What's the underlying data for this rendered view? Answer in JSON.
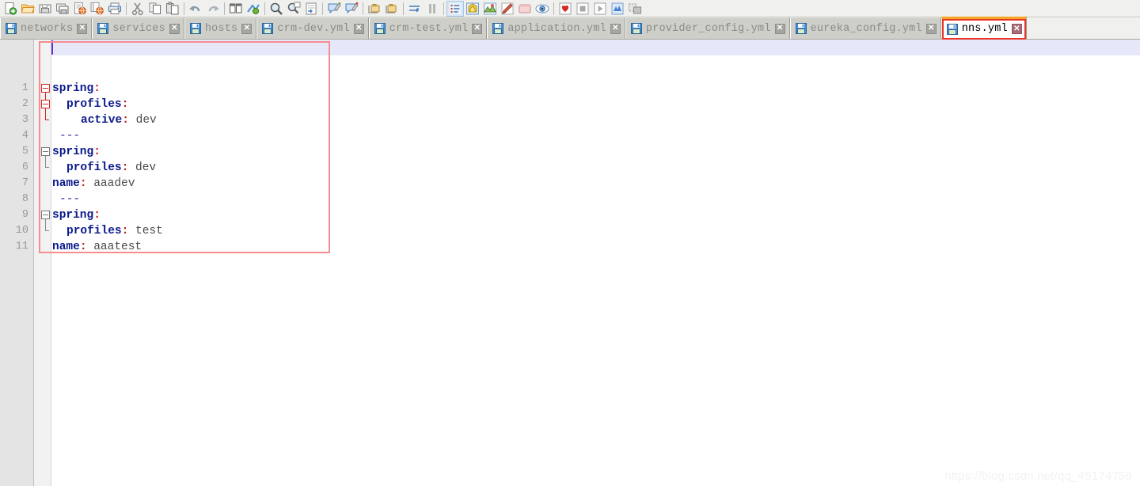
{
  "toolbar": {
    "groups": [
      {
        "items": [
          {
            "name": "new-file-icon",
            "label": "New"
          },
          {
            "name": "open-folder-icon",
            "label": "Open"
          },
          {
            "name": "save-icon",
            "label": "Save"
          },
          {
            "name": "save-all-icon",
            "label": "Save All"
          },
          {
            "name": "export-html-icon",
            "label": "Export to HTML"
          },
          {
            "name": "export-all-html-icon",
            "label": "Export All to HTML"
          },
          {
            "name": "print-icon",
            "label": "Print"
          }
        ]
      },
      {
        "items": [
          {
            "name": "cut-icon",
            "label": "Cut"
          },
          {
            "name": "copy-icon",
            "label": "Copy"
          },
          {
            "name": "paste-icon",
            "label": "Paste"
          }
        ]
      },
      {
        "items": [
          {
            "name": "undo-icon",
            "label": "Undo"
          },
          {
            "name": "redo-icon",
            "label": "Redo"
          }
        ]
      },
      {
        "items": [
          {
            "name": "compare-icon",
            "label": "Compare"
          },
          {
            "name": "sync-scroll-icon",
            "label": "Synchronize"
          }
        ]
      },
      {
        "items": [
          {
            "name": "find-icon",
            "label": "Find"
          },
          {
            "name": "replace-icon",
            "label": "Replace"
          },
          {
            "name": "goto-line-icon",
            "label": "Go To"
          }
        ]
      },
      {
        "items": [
          {
            "name": "comment-block-icon",
            "label": "Comment Block"
          },
          {
            "name": "uncomment-block-icon",
            "label": "Uncomment Block"
          }
        ]
      },
      {
        "items": [
          {
            "name": "indent-icon",
            "label": "Indent"
          },
          {
            "name": "column-mode-icon",
            "label": "Column Mode"
          }
        ]
      },
      {
        "items": [
          {
            "name": "show-all-chars-icon",
            "label": "Show All Characters"
          },
          {
            "name": "word-wrap-icon",
            "label": "Word Wrap"
          },
          {
            "name": "map-icon",
            "label": "Document Map"
          },
          {
            "name": "function-list-icon",
            "label": "Function List"
          },
          {
            "name": "folder-workspace-icon",
            "label": "Folder as Workspace"
          },
          {
            "name": "monitoring-icon",
            "label": "Monitoring"
          }
        ]
      },
      {
        "items": [
          {
            "name": "record-macro-icon",
            "label": "Start Recording"
          },
          {
            "name": "stop-macro-icon",
            "label": "Stop Recording"
          },
          {
            "name": "play-macro-icon",
            "label": "Playback"
          },
          {
            "name": "save-macro-icon",
            "label": "Save Macro"
          },
          {
            "name": "run-macro-multiple-icon",
            "label": "Run a Macro Multiple Times"
          }
        ]
      }
    ]
  },
  "tabs": [
    {
      "label": "networks",
      "active": false
    },
    {
      "label": "services",
      "active": false
    },
    {
      "label": "hosts",
      "active": false
    },
    {
      "label": "crm-dev.yml",
      "active": false
    },
    {
      "label": "crm-test.yml",
      "active": false
    },
    {
      "label": "application.yml",
      "active": false
    },
    {
      "label": "provider_config.yml",
      "active": false
    },
    {
      "label": "eureka_config.yml",
      "active": false
    },
    {
      "label": "nns.yml",
      "active": true
    }
  ],
  "tab_close_glyph": "✕",
  "editor": {
    "line_numbers": [
      "1",
      "2",
      "3",
      "4",
      "5",
      "6",
      "7",
      "8",
      "9",
      "10",
      "11"
    ],
    "lines": [
      {
        "n": 1,
        "indent": 0,
        "key": "spring",
        "colon": ":",
        "value": ""
      },
      {
        "n": 2,
        "indent": 1,
        "key": "profiles",
        "colon": ":",
        "value": ""
      },
      {
        "n": 3,
        "indent": 2,
        "key": "active",
        "colon": ":",
        "value": "dev"
      },
      {
        "n": 4,
        "indent": 0,
        "key": "",
        "colon": "",
        "value": "",
        "separator": "---"
      },
      {
        "n": 5,
        "indent": 0,
        "key": "spring",
        "colon": ":",
        "value": ""
      },
      {
        "n": 6,
        "indent": 1,
        "key": "profiles",
        "colon": ":",
        "value": "dev"
      },
      {
        "n": 7,
        "indent": 0,
        "key": "name",
        "colon": ":",
        "value": "aaadev"
      },
      {
        "n": 8,
        "indent": 0,
        "key": "",
        "colon": "",
        "value": "",
        "separator": "---"
      },
      {
        "n": 9,
        "indent": 0,
        "key": "spring",
        "colon": ":",
        "value": ""
      },
      {
        "n": 10,
        "indent": 1,
        "key": "profiles",
        "colon": ":",
        "value": "test"
      },
      {
        "n": 11,
        "indent": 0,
        "key": "name",
        "colon": ":",
        "value": "aaatest"
      }
    ]
  },
  "watermark": "https://blog.csdn.net/qq_45174759",
  "colors": {
    "key": "#0b1a8c",
    "colon": "#c41a1a",
    "value": "#4a4a4a",
    "separator": "#2a2aa8",
    "current_line": "#e7e7fa",
    "gutter": "#e4e4e4",
    "active_tab_top": "#f5a623",
    "annotation_box": "#f58e8e",
    "annotation_tab": "#e8352a"
  }
}
